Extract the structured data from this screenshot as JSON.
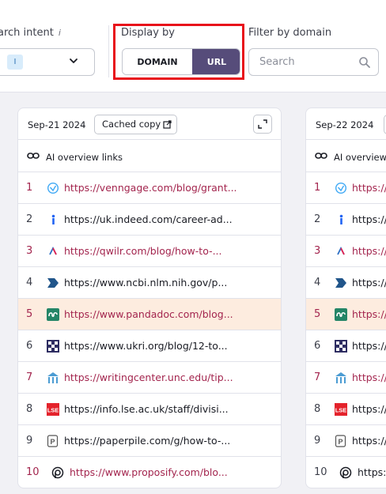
{
  "filters": {
    "search_intent_label": "arch intent",
    "intent_chip": "I",
    "display_by_label": "Display by",
    "display_options": [
      "DOMAIN",
      "URL"
    ],
    "display_selected": "URL",
    "filter_domain_label": "Filter by domain",
    "search_placeholder": "Search"
  },
  "columns": [
    {
      "date": "Sep-21 2024",
      "cached_label": "Cached copy",
      "overview_label": "AI overview links",
      "rows": [
        {
          "num": "1",
          "url": "https://venngage.com/blog/grant...",
          "icon": "venngage-icon",
          "visited": true
        },
        {
          "num": "2",
          "url": "https://uk.indeed.com/career-ad...",
          "icon": "indeed-icon",
          "visited": false
        },
        {
          "num": "3",
          "url": "https://qwilr.com/blog/how-to-...",
          "icon": "qwilr-icon",
          "visited": true
        },
        {
          "num": "4",
          "url": "https://www.ncbi.nlm.nih.gov/p...",
          "icon": "ncbi-icon",
          "visited": false
        },
        {
          "num": "5",
          "url": "https://www.pandadoc.com/blog...",
          "icon": "pandadoc-icon",
          "visited": true,
          "highlighted": true
        },
        {
          "num": "6",
          "url": "https://www.ukri.org/blog/12-to...",
          "icon": "ukri-icon",
          "visited": false
        },
        {
          "num": "7",
          "url": "https://writingcenter.unc.edu/tip...",
          "icon": "unc-icon",
          "visited": true
        },
        {
          "num": "8",
          "url": "https://info.lse.ac.uk/staff/divisi...",
          "icon": "lse-icon",
          "visited": false
        },
        {
          "num": "9",
          "url": "https://paperpile.com/g/how-to-...",
          "icon": "paperpile-icon",
          "visited": false
        },
        {
          "num": "10",
          "url": "https://www.proposify.com/blo...",
          "icon": "proposify-icon",
          "visited": true
        }
      ]
    },
    {
      "date": "Sep-22 2024",
      "overview_label": "AI overview",
      "rows": [
        {
          "num": "1",
          "url": "https://",
          "visited": true
        },
        {
          "num": "2",
          "url": "https://",
          "visited": false
        },
        {
          "num": "3",
          "url": "https://",
          "visited": true
        },
        {
          "num": "4",
          "url": "https://",
          "visited": false
        },
        {
          "num": "5",
          "url": "https://",
          "visited": true,
          "highlighted": true
        },
        {
          "num": "6",
          "url": "https://",
          "visited": false
        },
        {
          "num": "7",
          "url": "https://",
          "visited": true
        },
        {
          "num": "8",
          "url": "https://",
          "visited": false
        },
        {
          "num": "9",
          "url": "https://",
          "visited": false
        },
        {
          "num": "10",
          "url": "https:",
          "visited": false
        }
      ]
    }
  ],
  "colors": {
    "accent": "#564c7a",
    "visited_link": "#a3254e",
    "highlight_row": "#fdecdf",
    "annotation_box": "#e8101a"
  }
}
